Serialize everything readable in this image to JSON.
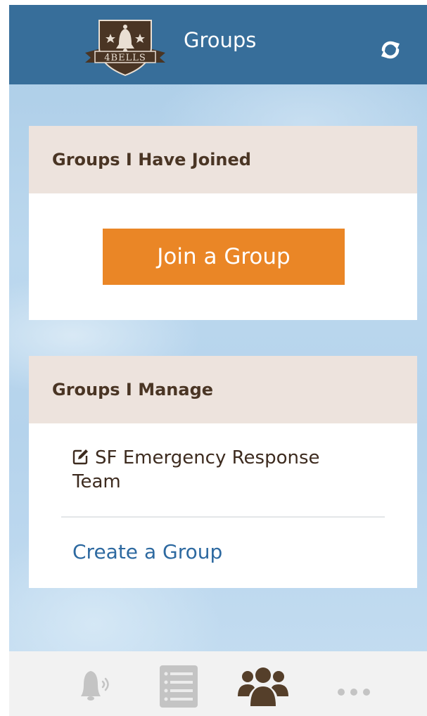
{
  "header": {
    "title": "Groups",
    "logo_text": "4BELLS",
    "refresh_icon": "refresh-icon"
  },
  "joined": {
    "heading": "Groups I Have Joined",
    "join_button_label": "Join a Group"
  },
  "managed": {
    "heading": "Groups I Manage",
    "items": [
      {
        "label": "SF Emergency Response Team",
        "icon": "edit-icon"
      }
    ],
    "create_link_label": "Create a Group"
  },
  "tabbar": {
    "tabs": [
      {
        "icon": "bell-icon",
        "active": false
      },
      {
        "icon": "list-icon",
        "active": false
      },
      {
        "icon": "groups-icon",
        "active": true
      },
      {
        "icon": "more-icon",
        "active": false
      }
    ]
  },
  "colors": {
    "header_bg": "#376e9a",
    "card_header_bg": "#ede3dd",
    "primary_button": "#ea8626",
    "link": "#2d69a0",
    "heading_text": "#4a3524",
    "active_tab": "#553f2a",
    "inactive_tab": "#c4c4c4"
  }
}
